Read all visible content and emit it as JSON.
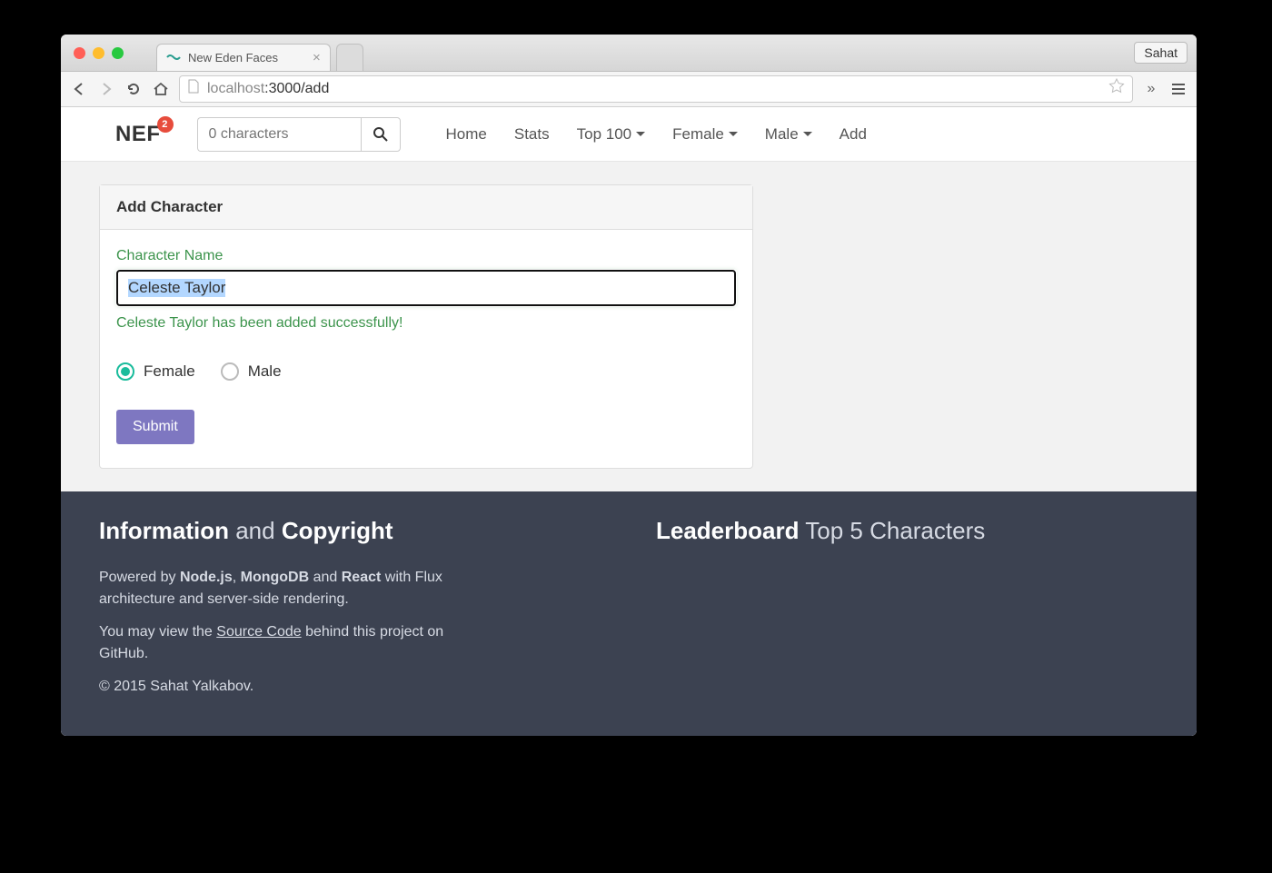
{
  "browser": {
    "tab_title": "New Eden Faces",
    "user_badge": "Sahat",
    "url_host": "localhost",
    "url_port": ":3000",
    "url_path": "/add"
  },
  "navbar": {
    "brand": "NEF",
    "badge": "2",
    "search_placeholder": "0 characters",
    "links": {
      "home": "Home",
      "stats": "Stats",
      "top100": "Top 100",
      "female": "Female",
      "male": "Male",
      "add": "Add"
    }
  },
  "panel": {
    "title": "Add Character",
    "name_label": "Character Name",
    "name_value": "Celeste Taylor",
    "success_msg": "Celeste Taylor has been added successfully!",
    "gender_female": "Female",
    "gender_male": "Male",
    "submit": "Submit"
  },
  "footer": {
    "info_title_1": "Information",
    "info_title_2": " and ",
    "info_title_3": "Copyright",
    "lead_title_1": "Leaderboard",
    "lead_title_2": " Top 5 Characters",
    "p1_a": "Powered by ",
    "p1_b": "Node.js",
    "p1_c": ", ",
    "p1_d": "MongoDB",
    "p1_e": " and ",
    "p1_f": "React",
    "p1_g": " with Flux architecture and server-side rendering.",
    "p2_a": "You may view the ",
    "p2_link": "Source Code",
    "p2_b": " behind this project on GitHub.",
    "copyright": "© 2015 Sahat Yalkabov."
  }
}
